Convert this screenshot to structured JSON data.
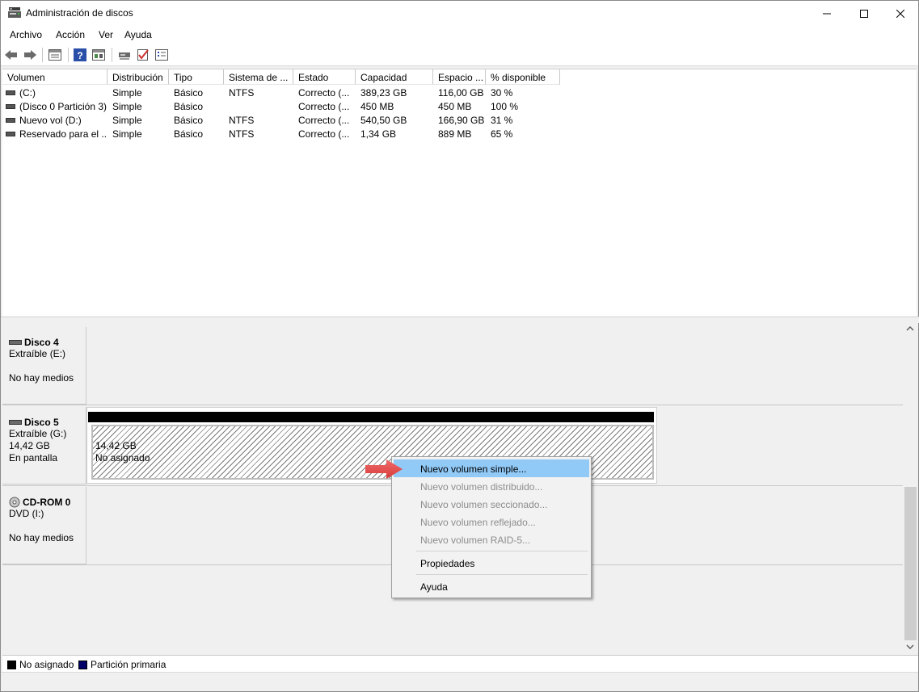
{
  "window": {
    "title": "Administración de discos"
  },
  "menu": {
    "items": [
      "Archivo",
      "Acción",
      "Ver",
      "Ayuda"
    ]
  },
  "columns": [
    "Volumen",
    "Distribución",
    "Tipo",
    "Sistema de ...",
    "Estado",
    "Capacidad",
    "Espacio ...",
    "% disponible"
  ],
  "volumes": [
    {
      "name": "(C:)",
      "layout": "Simple",
      "type": "Básico",
      "fs": "NTFS",
      "status": "Correcto (...",
      "capacity": "389,23 GB",
      "free": "116,00 GB",
      "pct": "30 %"
    },
    {
      "name": "(Disco 0 Partición 3)",
      "layout": "Simple",
      "type": "Básico",
      "fs": "",
      "status": "Correcto (...",
      "capacity": "450 MB",
      "free": "450 MB",
      "pct": "100 %"
    },
    {
      "name": "Nuevo vol (D:)",
      "layout": "Simple",
      "type": "Básico",
      "fs": "NTFS",
      "status": "Correcto (...",
      "capacity": "540,50 GB",
      "free": "166,90 GB",
      "pct": "31 %"
    },
    {
      "name": "Reservado para el ...",
      "layout": "Simple",
      "type": "Básico",
      "fs": "NTFS",
      "status": "Correcto (...",
      "capacity": "1,34 GB",
      "free": "889 MB",
      "pct": "65 %"
    }
  ],
  "disks": [
    {
      "name": "Disco 4",
      "line1": "Extraíble (E:)",
      "line2": "",
      "line3": "No hay medios"
    },
    {
      "name": "Disco 5",
      "line1": "Extraíble (G:)",
      "line2": "14,42 GB",
      "line3": "En pantalla"
    },
    {
      "name": "CD-ROM 0",
      "line1": "DVD (I:)",
      "line2": "",
      "line3": "No hay medios"
    }
  ],
  "partition": {
    "size": "14,42 GB",
    "state": "No asignado"
  },
  "context_menu": {
    "items": [
      {
        "label": "Nuevo volumen simple...",
        "enabled": true
      },
      {
        "label": "Nuevo volumen distribuido...",
        "enabled": false
      },
      {
        "label": "Nuevo volumen seccionado...",
        "enabled": false
      },
      {
        "label": "Nuevo volumen reflejado...",
        "enabled": false
      },
      {
        "label": "Nuevo volumen RAID-5...",
        "enabled": false
      },
      {
        "label": "Propiedades",
        "enabled": true
      },
      {
        "label": "Ayuda",
        "enabled": true
      }
    ]
  },
  "legend": [
    {
      "label": "No asignado",
      "color": "#000000"
    },
    {
      "label": "Partición primaria",
      "color": "#000066"
    }
  ],
  "colors": {
    "highlight": "#91c9f7",
    "arrow": "#e84a4a"
  }
}
